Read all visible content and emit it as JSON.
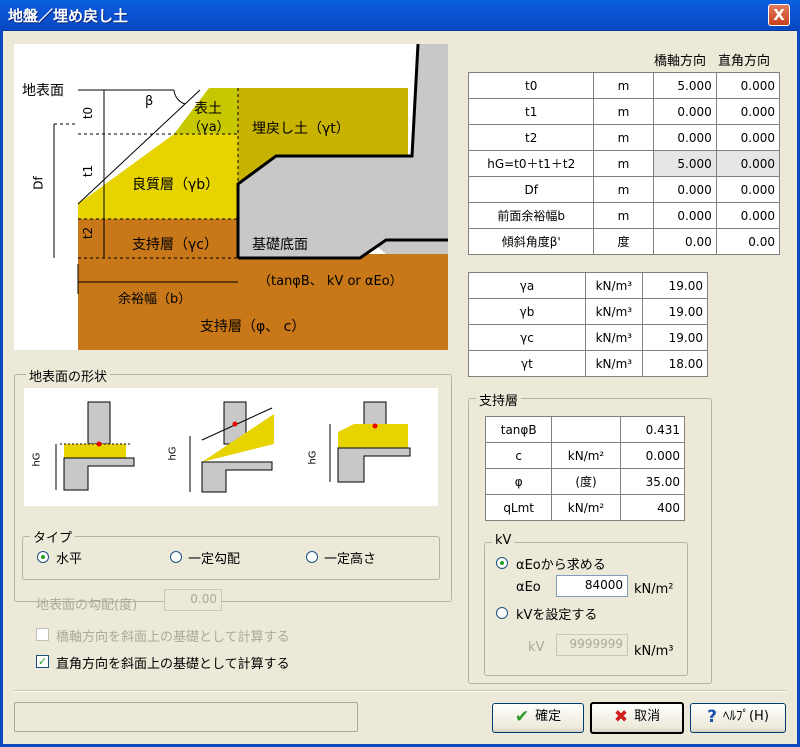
{
  "window": {
    "title": "地盤／埋め戻し土",
    "close_glyph": "X"
  },
  "diagram": {
    "labels": {
      "ground_surface": "地表面",
      "beta": "β",
      "surface_soil": "表土",
      "surface_soil_gamma": "（γa）",
      "backfill": "埋戻し土（γt）",
      "good_layer": "良質層（γb）",
      "bearing_layer": "支持層（γc）",
      "foundation_base": "基礎底面",
      "params": "（tanφB、 kV or αEo）",
      "margin_width": "余裕幅（b）",
      "bearing_bottom": "支持層（φ、 c）",
      "t0": "t0",
      "t1": "t1",
      "t2": "t2",
      "df": "Df"
    },
    "colors": {
      "surface": "#c8c800",
      "good": "#e6d300",
      "backfill": "#c8b400",
      "bearing": "#c87818",
      "structure": "#c8c8c8"
    }
  },
  "dims_table": {
    "col_headers": [
      "橋軸方向",
      "直角方向"
    ],
    "rows": [
      {
        "label": "t0",
        "unit": "m",
        "v1": "5.000",
        "v2": "0.000"
      },
      {
        "label": "t1",
        "unit": "m",
        "v1": "0.000",
        "v2": "0.000"
      },
      {
        "label": "t2",
        "unit": "m",
        "v1": "0.000",
        "v2": "0.000"
      },
      {
        "label": "hG=t0＋t1＋t2",
        "unit": "m",
        "v1": "5.000",
        "v2": "0.000"
      },
      {
        "label": "Df",
        "unit": "m",
        "v1": "0.000",
        "v2": "0.000"
      },
      {
        "label": "前面余裕幅b",
        "unit": "m",
        "v1": "0.000",
        "v2": "0.000"
      },
      {
        "label": "傾斜角度β'",
        "unit": "度",
        "v1": "0.00",
        "v2": "0.00"
      }
    ]
  },
  "gamma_table": {
    "rows": [
      {
        "label": "γa",
        "unit": "kN/m³",
        "value": "19.00"
      },
      {
        "label": "γb",
        "unit": "kN/m³",
        "value": "19.00"
      },
      {
        "label": "γc",
        "unit": "kN/m³",
        "value": "19.00"
      },
      {
        "label": "γt",
        "unit": "kN/m³",
        "value": "18.00"
      }
    ]
  },
  "bearing": {
    "title": "支持層",
    "rows": [
      {
        "label": "tanφB",
        "unit": "",
        "value": "0.431"
      },
      {
        "label": "c",
        "unit": "kN/m²",
        "value": "0.000"
      },
      {
        "label": "φ",
        "unit": "(度)",
        "value": "35.00"
      },
      {
        "label": "qLmt",
        "unit": "kN/m²",
        "value": "400"
      }
    ],
    "kv": {
      "title": "kV",
      "option1": "αEoから求める",
      "aeo_label": "αEo",
      "aeo_value": "84000",
      "aeo_unit": "kN/m²",
      "option2": "kVを設定する",
      "kv_label": "kV",
      "kv_value": "9999999",
      "kv_unit": "kN/m³"
    }
  },
  "shape_group": {
    "title": "地表面の形状",
    "hg_label": "hG"
  },
  "type_group": {
    "title": "タイプ",
    "options": [
      "水平",
      "一定勾配",
      "一定高さ"
    ],
    "selected": "水平"
  },
  "slope": {
    "label": "地表面の勾配(度)",
    "value": "0.00"
  },
  "checks": {
    "bridge_axis": "橋軸方向を斜面上の基礎として計算する",
    "perpendicular": "直角方向を斜面上の基礎として計算する"
  },
  "buttons": {
    "ok": "確定",
    "cancel": "取消",
    "help": "ﾍﾙﾌﾟ(H)"
  }
}
